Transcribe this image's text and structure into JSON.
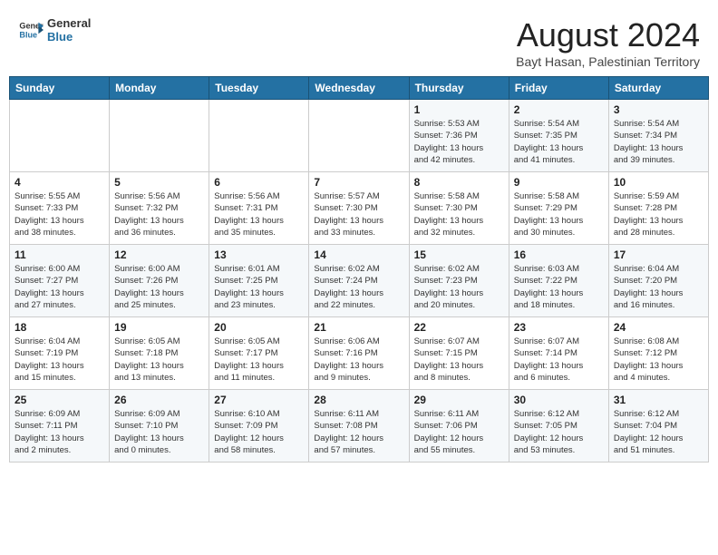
{
  "header": {
    "logo_line1": "General",
    "logo_line2": "Blue",
    "main_title": "August 2024",
    "subtitle": "Bayt Hasan, Palestinian Territory"
  },
  "days_of_week": [
    "Sunday",
    "Monday",
    "Tuesday",
    "Wednesday",
    "Thursday",
    "Friday",
    "Saturday"
  ],
  "weeks": [
    [
      {
        "day": "",
        "info": ""
      },
      {
        "day": "",
        "info": ""
      },
      {
        "day": "",
        "info": ""
      },
      {
        "day": "",
        "info": ""
      },
      {
        "day": "1",
        "info": "Sunrise: 5:53 AM\nSunset: 7:36 PM\nDaylight: 13 hours\nand 42 minutes."
      },
      {
        "day": "2",
        "info": "Sunrise: 5:54 AM\nSunset: 7:35 PM\nDaylight: 13 hours\nand 41 minutes."
      },
      {
        "day": "3",
        "info": "Sunrise: 5:54 AM\nSunset: 7:34 PM\nDaylight: 13 hours\nand 39 minutes."
      }
    ],
    [
      {
        "day": "4",
        "info": "Sunrise: 5:55 AM\nSunset: 7:33 PM\nDaylight: 13 hours\nand 38 minutes."
      },
      {
        "day": "5",
        "info": "Sunrise: 5:56 AM\nSunset: 7:32 PM\nDaylight: 13 hours\nand 36 minutes."
      },
      {
        "day": "6",
        "info": "Sunrise: 5:56 AM\nSunset: 7:31 PM\nDaylight: 13 hours\nand 35 minutes."
      },
      {
        "day": "7",
        "info": "Sunrise: 5:57 AM\nSunset: 7:30 PM\nDaylight: 13 hours\nand 33 minutes."
      },
      {
        "day": "8",
        "info": "Sunrise: 5:58 AM\nSunset: 7:30 PM\nDaylight: 13 hours\nand 32 minutes."
      },
      {
        "day": "9",
        "info": "Sunrise: 5:58 AM\nSunset: 7:29 PM\nDaylight: 13 hours\nand 30 minutes."
      },
      {
        "day": "10",
        "info": "Sunrise: 5:59 AM\nSunset: 7:28 PM\nDaylight: 13 hours\nand 28 minutes."
      }
    ],
    [
      {
        "day": "11",
        "info": "Sunrise: 6:00 AM\nSunset: 7:27 PM\nDaylight: 13 hours\nand 27 minutes."
      },
      {
        "day": "12",
        "info": "Sunrise: 6:00 AM\nSunset: 7:26 PM\nDaylight: 13 hours\nand 25 minutes."
      },
      {
        "day": "13",
        "info": "Sunrise: 6:01 AM\nSunset: 7:25 PM\nDaylight: 13 hours\nand 23 minutes."
      },
      {
        "day": "14",
        "info": "Sunrise: 6:02 AM\nSunset: 7:24 PM\nDaylight: 13 hours\nand 22 minutes."
      },
      {
        "day": "15",
        "info": "Sunrise: 6:02 AM\nSunset: 7:23 PM\nDaylight: 13 hours\nand 20 minutes."
      },
      {
        "day": "16",
        "info": "Sunrise: 6:03 AM\nSunset: 7:22 PM\nDaylight: 13 hours\nand 18 minutes."
      },
      {
        "day": "17",
        "info": "Sunrise: 6:04 AM\nSunset: 7:20 PM\nDaylight: 13 hours\nand 16 minutes."
      }
    ],
    [
      {
        "day": "18",
        "info": "Sunrise: 6:04 AM\nSunset: 7:19 PM\nDaylight: 13 hours\nand 15 minutes."
      },
      {
        "day": "19",
        "info": "Sunrise: 6:05 AM\nSunset: 7:18 PM\nDaylight: 13 hours\nand 13 minutes."
      },
      {
        "day": "20",
        "info": "Sunrise: 6:05 AM\nSunset: 7:17 PM\nDaylight: 13 hours\nand 11 minutes."
      },
      {
        "day": "21",
        "info": "Sunrise: 6:06 AM\nSunset: 7:16 PM\nDaylight: 13 hours\nand 9 minutes."
      },
      {
        "day": "22",
        "info": "Sunrise: 6:07 AM\nSunset: 7:15 PM\nDaylight: 13 hours\nand 8 minutes."
      },
      {
        "day": "23",
        "info": "Sunrise: 6:07 AM\nSunset: 7:14 PM\nDaylight: 13 hours\nand 6 minutes."
      },
      {
        "day": "24",
        "info": "Sunrise: 6:08 AM\nSunset: 7:12 PM\nDaylight: 13 hours\nand 4 minutes."
      }
    ],
    [
      {
        "day": "25",
        "info": "Sunrise: 6:09 AM\nSunset: 7:11 PM\nDaylight: 13 hours\nand 2 minutes."
      },
      {
        "day": "26",
        "info": "Sunrise: 6:09 AM\nSunset: 7:10 PM\nDaylight: 13 hours\nand 0 minutes."
      },
      {
        "day": "27",
        "info": "Sunrise: 6:10 AM\nSunset: 7:09 PM\nDaylight: 12 hours\nand 58 minutes."
      },
      {
        "day": "28",
        "info": "Sunrise: 6:11 AM\nSunset: 7:08 PM\nDaylight: 12 hours\nand 57 minutes."
      },
      {
        "day": "29",
        "info": "Sunrise: 6:11 AM\nSunset: 7:06 PM\nDaylight: 12 hours\nand 55 minutes."
      },
      {
        "day": "30",
        "info": "Sunrise: 6:12 AM\nSunset: 7:05 PM\nDaylight: 12 hours\nand 53 minutes."
      },
      {
        "day": "31",
        "info": "Sunrise: 6:12 AM\nSunset: 7:04 PM\nDaylight: 12 hours\nand 51 minutes."
      }
    ]
  ]
}
